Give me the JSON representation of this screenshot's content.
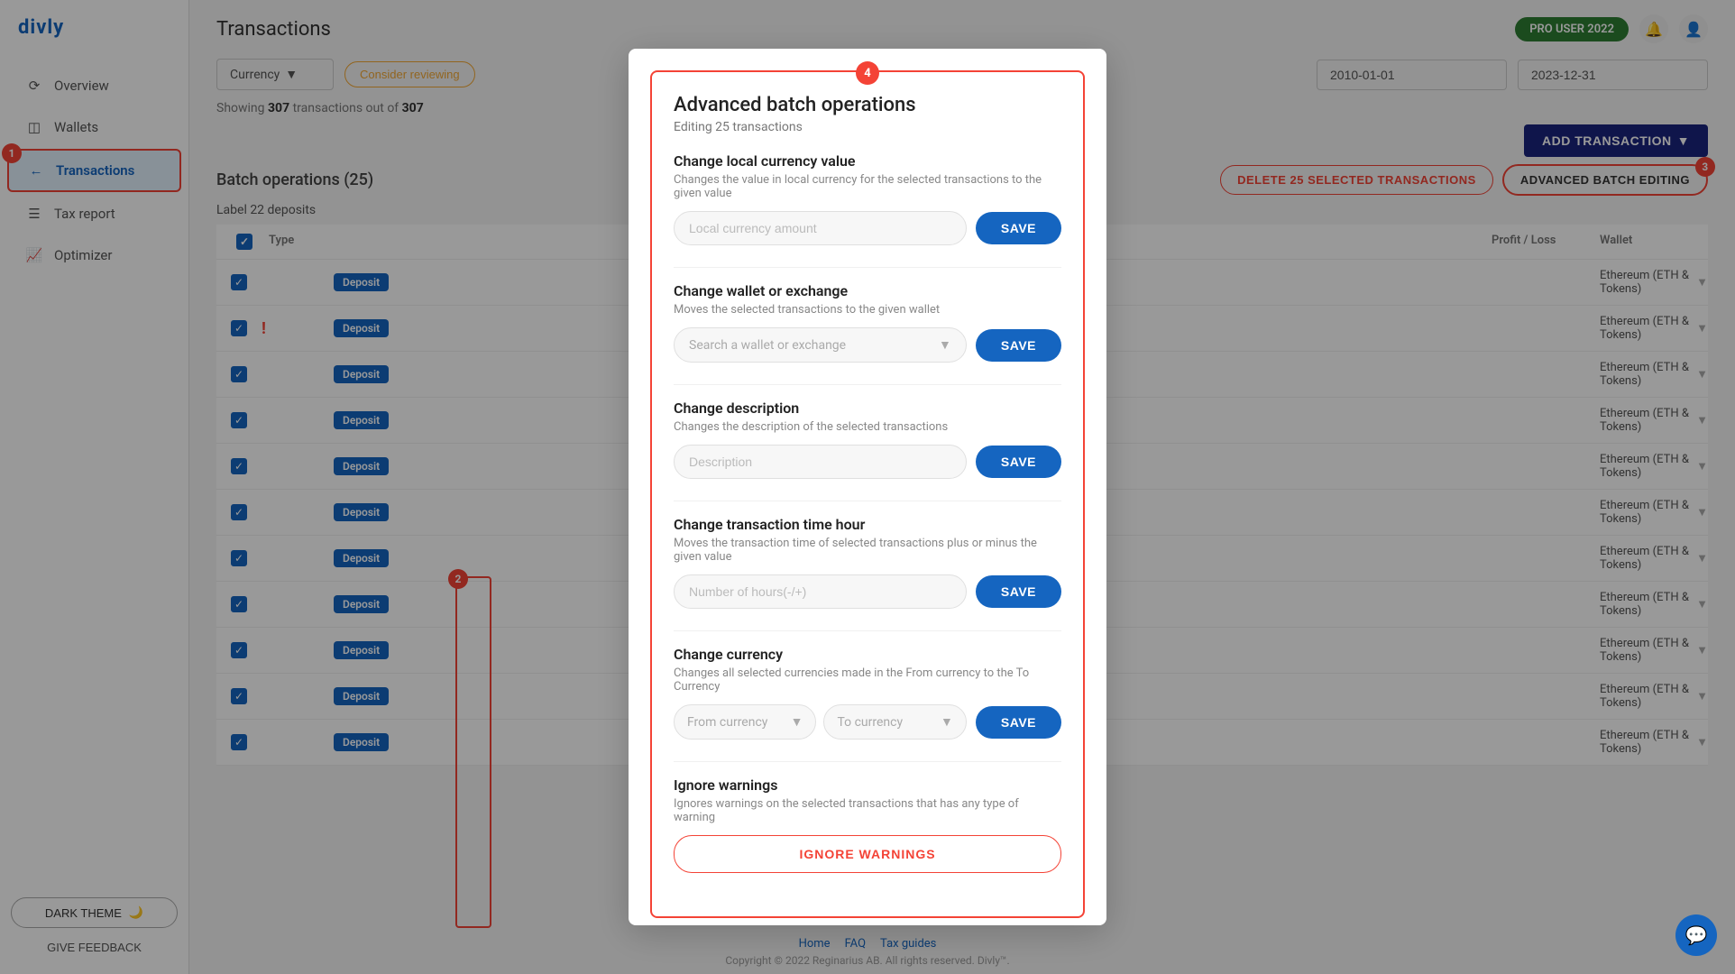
{
  "app": {
    "logo": "divly",
    "pro_badge": "PRO USER 2022"
  },
  "sidebar": {
    "items": [
      {
        "id": "overview",
        "label": "Overview",
        "icon": "⟳"
      },
      {
        "id": "wallets",
        "label": "Wallets",
        "icon": "◫"
      },
      {
        "id": "transactions",
        "label": "Transactions",
        "icon": "←",
        "active": true,
        "badge": "1"
      },
      {
        "id": "tax-report",
        "label": "Tax report",
        "icon": "☰"
      },
      {
        "id": "optimizer",
        "label": "Optimizer",
        "icon": "📈"
      }
    ],
    "dark_theme_label": "DARK THEME",
    "give_feedback_label": "GIVE FEEDBACK"
  },
  "main": {
    "page_title": "Transactions",
    "currency_label": "Currency",
    "consider_reviewing_label": "Consider reviewing",
    "showing_text": "Showing ",
    "showing_count": "307",
    "showing_of": " transactions out of ",
    "showing_total": "307",
    "date_from": "2010-01-01",
    "date_to": "2023-12-31",
    "add_transaction_label": "ADD TRANSACTION",
    "batch_operations_title": "Batch operations (25)",
    "label_deposits": "Label 22 deposits",
    "delete_btn_label": "DELETE 25 SELECTED TRANSACTIONS",
    "advanced_btn_label": "ADVANCED BATCH EDITING",
    "advanced_btn_badge": "3"
  },
  "table": {
    "headers": [
      "",
      "Type",
      "",
      "",
      "Profit / Loss",
      "Wallet"
    ],
    "rows": [
      {
        "type": "Deposit",
        "warning": false
      },
      {
        "type": "Deposit",
        "warning": true
      },
      {
        "type": "Deposit",
        "warning": false
      },
      {
        "type": "Deposit",
        "warning": false
      },
      {
        "type": "Deposit",
        "warning": false
      },
      {
        "type": "Deposit",
        "warning": false
      },
      {
        "type": "Deposit",
        "warning": false
      },
      {
        "type": "Deposit",
        "warning": false
      },
      {
        "type": "Deposit",
        "warning": false
      },
      {
        "type": "Deposit",
        "warning": false
      },
      {
        "type": "Deposit",
        "warning": false
      }
    ],
    "wallet_label": "Ethereum (ETH & Tokens)"
  },
  "modal": {
    "badge": "4",
    "title": "Advanced batch operations",
    "subtitle": "Editing 25 transactions",
    "sections": [
      {
        "id": "local-currency",
        "title": "Change local currency value",
        "desc": "Changes the value in local currency for the selected transactions to the given value",
        "input_placeholder": "Local currency amount",
        "save_label": "SAVE"
      },
      {
        "id": "wallet-exchange",
        "title": "Change wallet or exchange",
        "desc": "Moves the selected transactions to the given wallet",
        "input_placeholder": "Search a wallet or exchange",
        "save_label": "SAVE"
      },
      {
        "id": "description",
        "title": "Change description",
        "desc": "Changes the description of the selected transactions",
        "input_placeholder": "Description",
        "save_label": "SAVE"
      },
      {
        "id": "time-hour",
        "title": "Change transaction time hour",
        "desc": "Moves the transaction time of selected transactions plus or minus the given value",
        "input_placeholder": "Number of hours(-/+)",
        "save_label": "SAVE"
      },
      {
        "id": "currency",
        "title": "Change currency",
        "desc": "Changes all selected currencies made in the From currency to the To Currency",
        "from_label": "From currency",
        "to_label": "To currency",
        "save_label": "SAVE"
      },
      {
        "id": "ignore-warnings",
        "title": "Ignore warnings",
        "desc": "Ignores warnings on the selected transactions that has any type of warning",
        "ignore_label": "IGNORE WARNINGS"
      }
    ]
  },
  "footer": {
    "links": [
      "Home",
      "FAQ",
      "Tax guides"
    ],
    "copyright": "Copyright © 2022 Reginarius AB. All rights reserved. Divly™."
  },
  "chat_icon": "💬"
}
